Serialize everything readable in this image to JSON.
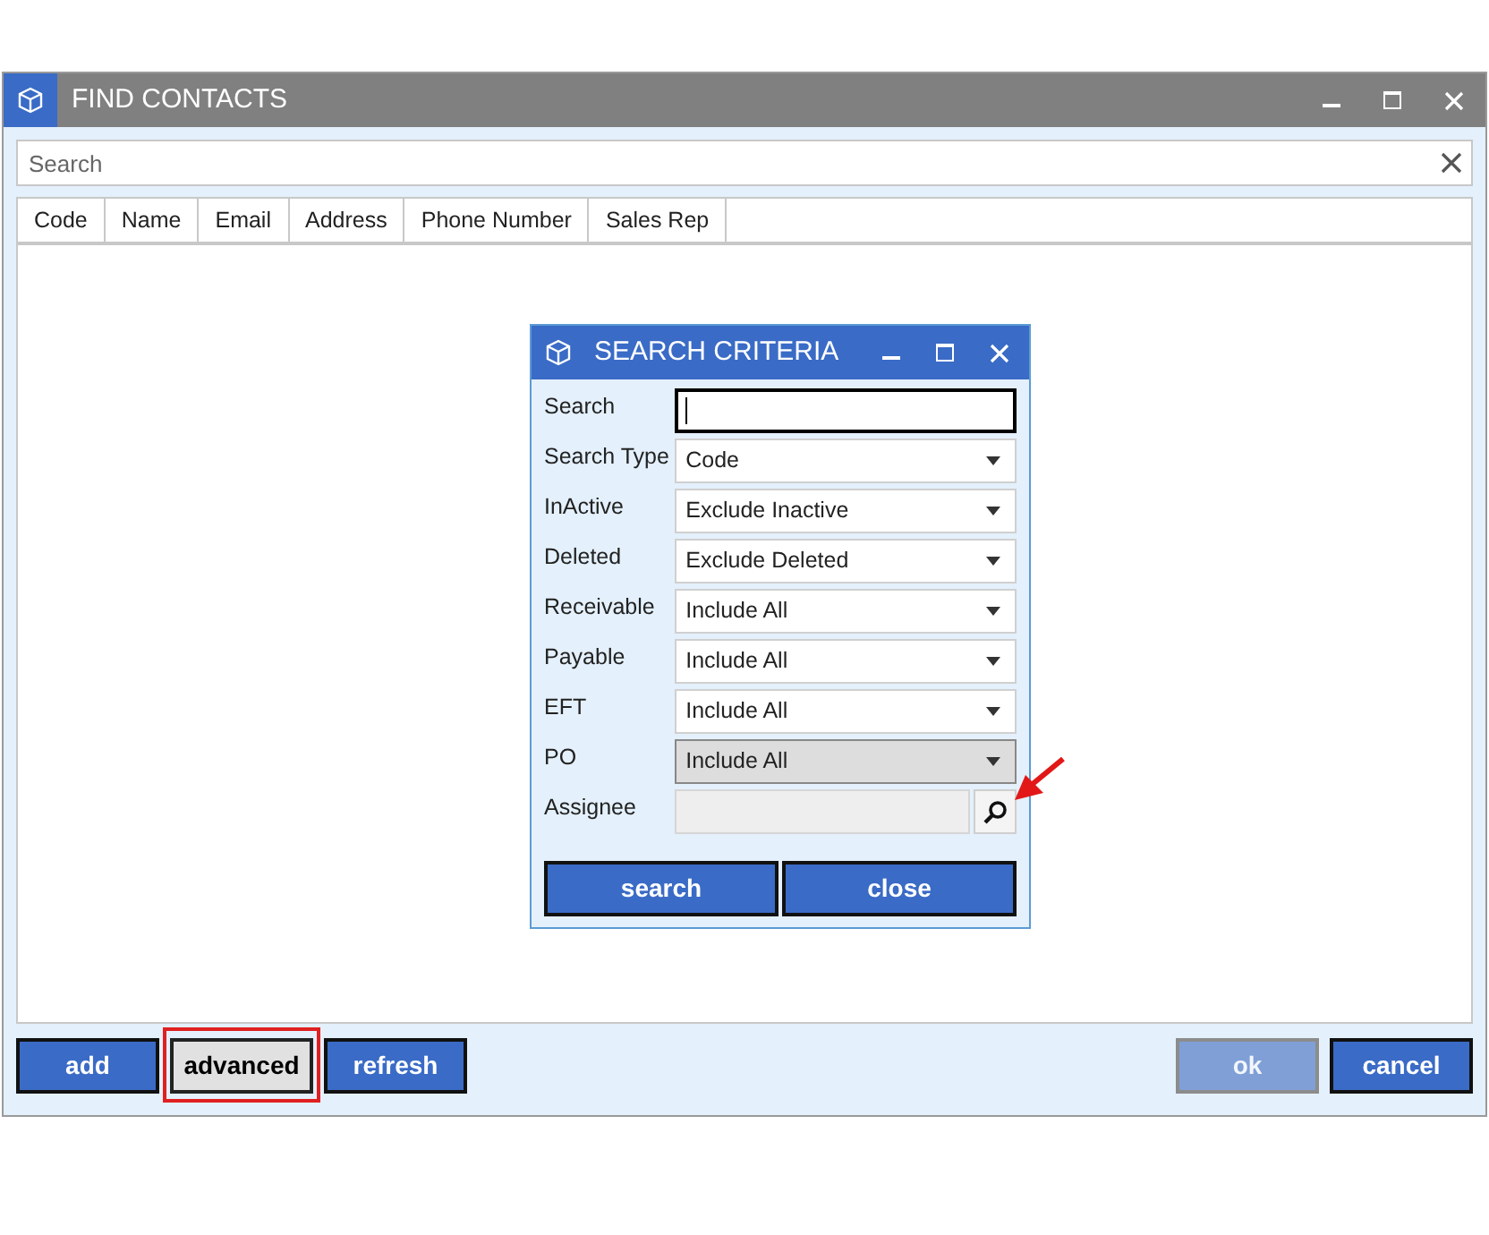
{
  "window": {
    "title": "FIND CONTACTS"
  },
  "search": {
    "placeholder": "Search"
  },
  "table": {
    "columns": [
      "Code",
      "Name",
      "Email",
      "Address",
      "Phone Number",
      "Sales Rep"
    ]
  },
  "dialog": {
    "title": "SEARCH CRITERIA",
    "fields": [
      {
        "label": "Search",
        "kind": "text",
        "focused": true
      },
      {
        "label": "Search Type",
        "kind": "select",
        "value": "Code",
        "highlighted": false
      },
      {
        "label": "InActive",
        "kind": "select",
        "value": "Exclude Inactive",
        "highlighted": false
      },
      {
        "label": "Deleted",
        "kind": "select",
        "value": "Exclude Deleted",
        "highlighted": false
      },
      {
        "label": "Receivable",
        "kind": "select",
        "value": "Include All",
        "highlighted": false
      },
      {
        "label": "Payable",
        "kind": "select",
        "value": "Include All",
        "highlighted": false
      },
      {
        "label": "EFT",
        "kind": "select",
        "value": "Include All",
        "highlighted": false
      },
      {
        "label": "PO",
        "kind": "select",
        "value": "Include All",
        "highlighted": true
      },
      {
        "label": "Assignee",
        "kind": "lookup",
        "pointed_at": true
      }
    ],
    "buttons": [
      "search",
      "close"
    ]
  },
  "buttons_left": [
    {
      "label": "add",
      "highlighted": false
    },
    {
      "label": "advanced",
      "highlighted": true
    },
    {
      "label": "refresh",
      "highlighted": false
    }
  ],
  "buttons_right": [
    {
      "label": "ok",
      "disabled": true
    },
    {
      "label": "cancel",
      "disabled": false
    }
  ]
}
